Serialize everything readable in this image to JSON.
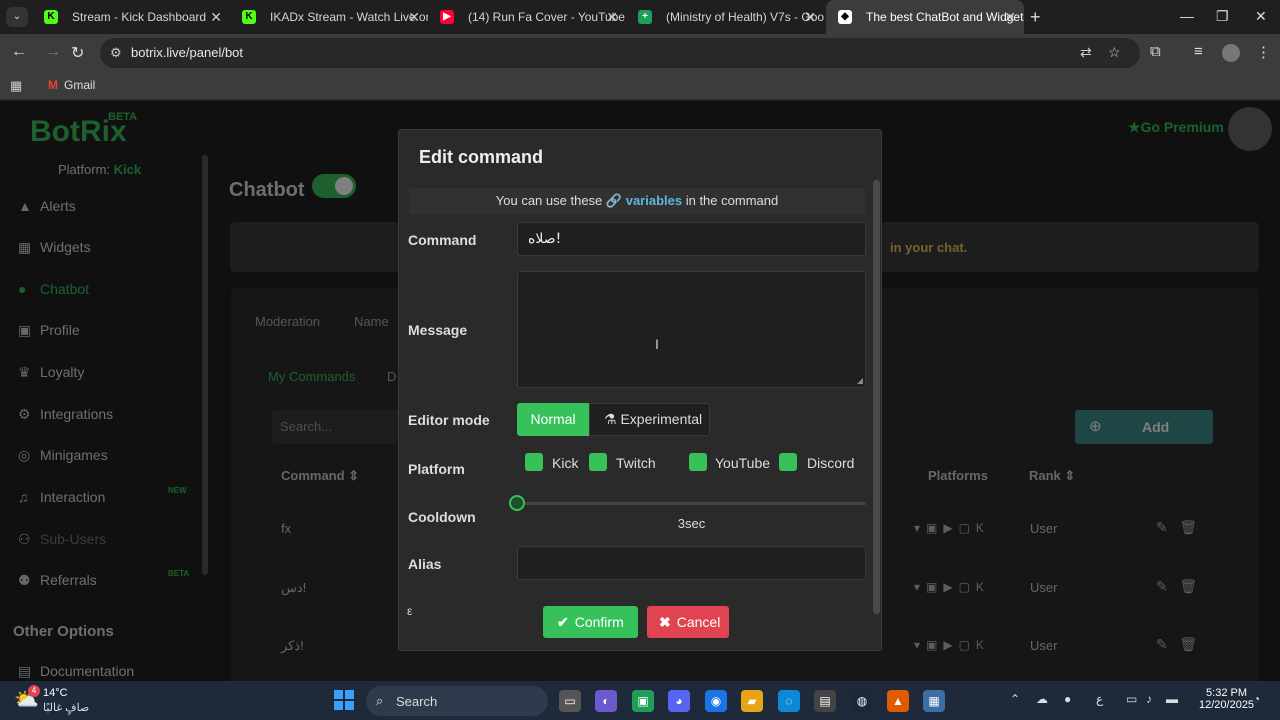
{
  "browser": {
    "tabs": [
      {
        "title": "Stream - Kick Dashboard",
        "active": false
      },
      {
        "title": "IKADx Stream - Watch Live on K",
        "active": false
      },
      {
        "title": "(14) Run Fa Cover - YouTube",
        "active": false
      },
      {
        "title": "(Ministry of Health) V7s - Goog",
        "active": false
      },
      {
        "title": "The best ChatBot and Widgets",
        "active": true
      }
    ],
    "url": "botrix.live/panel/bot",
    "bookmarks": [
      "Gmail"
    ]
  },
  "app": {
    "logo": "BotRix",
    "beta": "BETA",
    "platform_label": "Platform:",
    "platform_value": "Kick",
    "go_premium": "Go Premium",
    "sidebar": [
      {
        "label": "Alerts",
        "icon": "alerts-icon"
      },
      {
        "label": "Widgets",
        "icon": "widgets-icon"
      },
      {
        "label": "Chatbot",
        "icon": "chatbot-icon",
        "active": true
      },
      {
        "label": "Profile",
        "icon": "profile-icon"
      },
      {
        "label": "Loyalty",
        "icon": "trophy-icon"
      },
      {
        "label": "Integrations",
        "icon": "integrations-icon"
      },
      {
        "label": "Minigames",
        "icon": "gamepad-icon"
      },
      {
        "label": "Interaction",
        "icon": "music-icon",
        "badge": "NEW"
      },
      {
        "label": "Sub-Users",
        "icon": "users-icon"
      },
      {
        "label": "Referrals",
        "icon": "referrals-icon",
        "badge": "BETA"
      }
    ],
    "other_options_title": "Other Options",
    "documentation": "Documentation",
    "chatbot_heading": "Chatbot",
    "banner_text": "in your chat.",
    "panel_tabs": [
      "Moderation",
      "Name"
    ],
    "subtabs": [
      "My Commands",
      "D"
    ],
    "search_placeholder": "Search...",
    "add_label": "Add",
    "table": {
      "headers": {
        "command": "Command",
        "platforms": "Platforms",
        "rank": "Rank"
      },
      "rows": [
        {
          "command": "fx",
          "rank": "User"
        },
        {
          "command": "دس!",
          "rank": "User"
        },
        {
          "command": "ذكر!",
          "rank": "User"
        }
      ]
    }
  },
  "modal": {
    "title": "Edit command",
    "info_prefix": "You can use these",
    "info_link": "variables",
    "info_suffix": "in the command",
    "command_label": "Command",
    "command_value": "صلاه!",
    "message_label": "Message",
    "message_value": "",
    "editor_mode_label": "Editor mode",
    "mode_normal": "Normal",
    "mode_experimental": "Experimental",
    "platform_label": "Platform",
    "platforms": [
      {
        "name": "Kick",
        "checked": true
      },
      {
        "name": "Twitch",
        "checked": true
      },
      {
        "name": "YouTube",
        "checked": true
      },
      {
        "name": "Discord",
        "checked": true
      }
    ],
    "cooldown_label": "Cooldown",
    "cooldown_value": "3sec",
    "alias_label": "Alias",
    "alias_value": "",
    "cut_label": "ε",
    "confirm": "Confirm",
    "cancel": "Cancel"
  },
  "taskbar": {
    "weather_badge": "4",
    "temperature": "14°C",
    "condition": "صافٍ غالبًا",
    "search": "Search",
    "lang": "ع",
    "time": "5:32 PM",
    "date": "12/20/2025"
  }
}
